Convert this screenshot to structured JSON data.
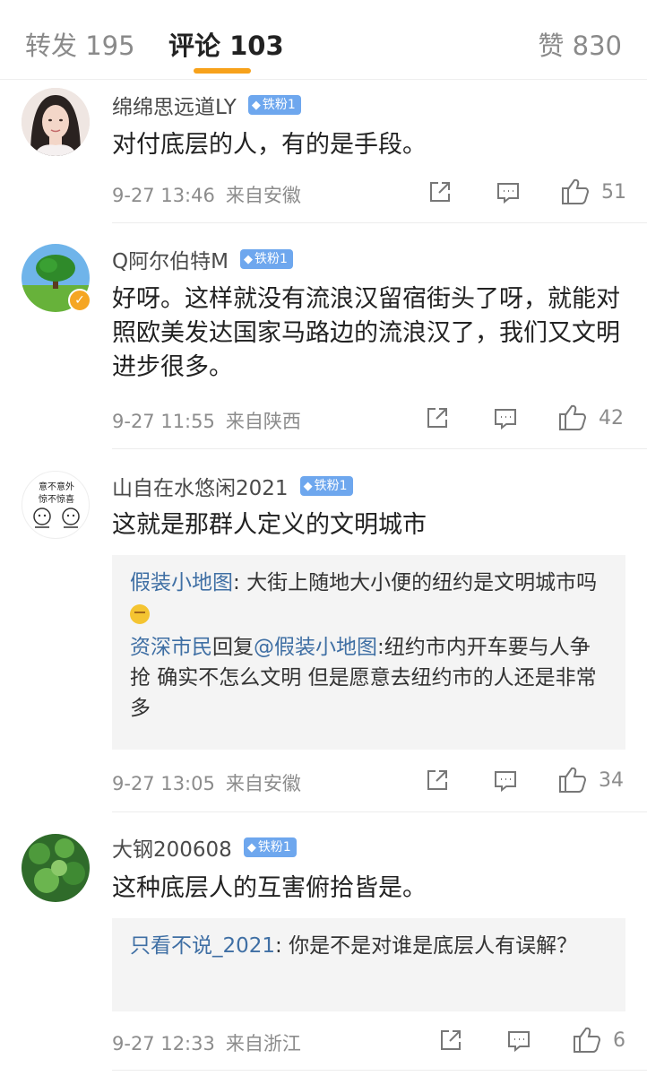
{
  "tabs": {
    "repost": {
      "label": "转发",
      "count": "195"
    },
    "comment": {
      "label": "评论",
      "count": "103"
    },
    "like": {
      "label": "赞",
      "count": "830"
    }
  },
  "comments": [
    {
      "username": "绵绵思远道LY",
      "badge": "铁粉1",
      "text": "对付底层的人，有的是手段。",
      "date": "9-27 13:46",
      "location": "来自安徽",
      "likes": "51"
    },
    {
      "username": "Q阿尔伯特M",
      "badge": "铁粉1",
      "text": "好呀。这样就没有流浪汉留宿街头了呀，就能对照欧美发达国家马路边的流浪汉了，我们又文明进步很多。",
      "date": "9-27 11:55",
      "location": "来自陕西",
      "likes": "42"
    },
    {
      "username": "山自在水悠闲2021",
      "badge": "铁粉1",
      "text": "这就是那群人定义的文明城市",
      "replies": [
        {
          "user": "假装小地图",
          "sep": ": ",
          "text": "大街上随地大小便的纽约是文明城市吗"
        },
        {
          "user": "资深市民",
          "mid": "回复",
          "mention": "@假装小地图",
          "sep": ":",
          "text": "纽约市内开车要与人争抢 确实不怎么文明 但是愿意去纽约市的人还是非常多"
        }
      ],
      "date": "9-27 13:05",
      "location": "来自安徽",
      "likes": "34",
      "avatar_text": [
        "意不意外",
        "惊不惊喜"
      ]
    },
    {
      "username": "大钢200608",
      "badge": "铁粉1",
      "text": "这种底层人的互害俯拾皆是。",
      "replies": [
        {
          "user": "只看不说_2021",
          "sep": ": ",
          "text": "你是不是对谁是底层人有误解？"
        }
      ],
      "date": "9-27 12:33",
      "location": "来自浙江",
      "likes": "6"
    }
  ],
  "colors": {
    "accent": "#f7a21b",
    "link": "#3f6fa4",
    "badge": "#6ea7ee"
  }
}
